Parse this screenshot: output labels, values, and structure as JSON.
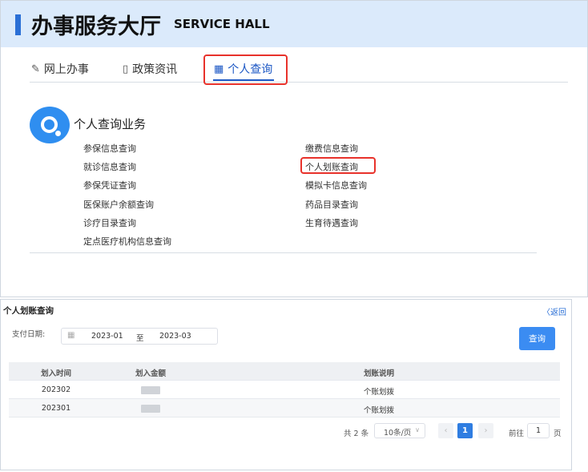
{
  "header": {
    "title_cn": "办事服务大厅",
    "title_en": "SERVICE HALL"
  },
  "tabs": [
    {
      "label": "网上办事",
      "icon": "edit-icon"
    },
    {
      "label": "政策资讯",
      "icon": "book-icon"
    },
    {
      "label": "个人查询",
      "icon": "calendar-icon",
      "active": true
    }
  ],
  "section": {
    "title": "个人查询业务",
    "links_left": [
      "参保信息查询",
      "就诊信息查询",
      "参保凭证查询",
      "医保账户余额查询",
      "诊疗目录查询",
      "定点医疗机构信息查询"
    ],
    "links_right": [
      "缴费信息查询",
      "个人划账查询",
      "模拟卡信息查询",
      "药品目录查询",
      "生育待遇查询"
    ]
  },
  "detail": {
    "title": "个人划账查询",
    "back": "〈返回",
    "filter_label": "支付日期:",
    "date_from": "2023-01",
    "date_sep": "至",
    "date_to": "2023-03",
    "query_button": "查询",
    "columns": [
      "划入时间",
      "划入金额",
      "划账说明"
    ],
    "rows": [
      {
        "time": "202302",
        "desc": "个账划拨"
      },
      {
        "time": "202301",
        "desc": "个账划拨"
      }
    ],
    "pager": {
      "total": "共 2 条",
      "page_size": "10条/页",
      "current": "1",
      "goto_label": "前往",
      "goto_value": "1",
      "page_suffix": "页"
    }
  },
  "colors": {
    "header_bg": "#dbeafb",
    "accent": "#2a6fd6",
    "highlight": "#e8322b",
    "query_btn": "#3b8cf2"
  }
}
